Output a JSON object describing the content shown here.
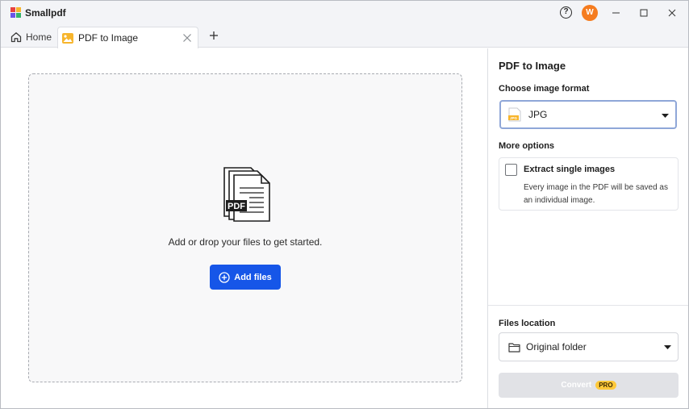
{
  "app": {
    "name": "Smallpdf",
    "avatar_initial": "W",
    "avatar_color": "#f57c1f"
  },
  "titlebar": {
    "help_label": "?"
  },
  "tabs": [
    {
      "label": "Home",
      "icon": "home-icon",
      "active": false
    },
    {
      "label": "PDF to Image",
      "icon": "image-icon",
      "active": true
    }
  ],
  "dropzone": {
    "illustration_label": "PDF",
    "prompt": "Add or drop your files to get started.",
    "button_label": "Add files"
  },
  "panel": {
    "title": "PDF to Image",
    "format_label": "Choose image format",
    "format_value": "JPG",
    "format_icon_text": "JPG",
    "more_options_label": "More options",
    "extract_title": "Extract single images",
    "extract_desc": "Every image in the PDF will be saved as an individual image.",
    "extract_checked": false,
    "location_label": "Files location",
    "location_value": "Original folder",
    "convert_label": "Convert",
    "pro_badge": "PRO"
  },
  "colors": {
    "accent": "#1656e8",
    "pro": "#ffc93b"
  }
}
